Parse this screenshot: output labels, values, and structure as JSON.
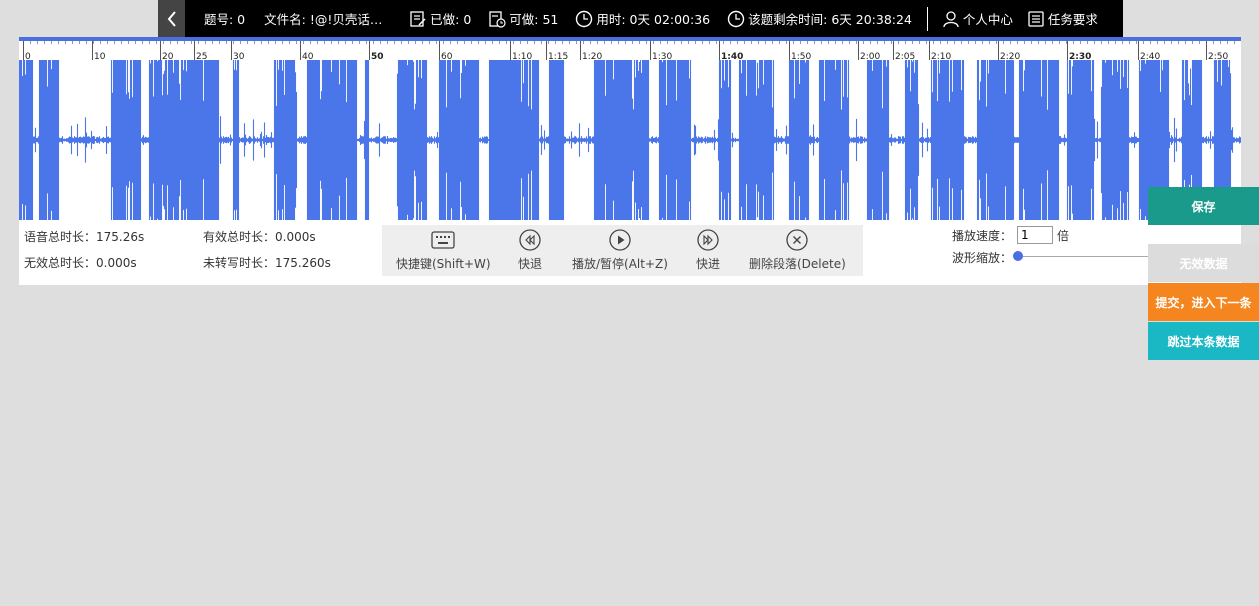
{
  "topbar": {
    "question_no": "题号: 0",
    "file_name": "文件名: !@!贝壳话…",
    "done": "已做: 0",
    "available": "可做: 51",
    "time_used": "用时: 0天 02:00:36",
    "time_left": "该题剩余时间: 6天 20:38:24",
    "user_center": "个人中心",
    "task_requirements": "任务要求"
  },
  "timeline": {
    "labels": [
      "0",
      "10",
      "20",
      "25",
      "30",
      "40",
      "50",
      "60",
      "1:10",
      "1:15",
      "1:20",
      "1:30",
      "1:40",
      "1:50",
      "2:00",
      "2:05",
      "2:10",
      "2:20",
      "2:30",
      "2:40",
      "2:50"
    ],
    "bold_labels": [
      "50",
      "1:40",
      "2:30"
    ]
  },
  "stats": {
    "speech_total": "语音总时长：175.26s",
    "valid_total": "有效总时长：0.000s",
    "invalid_total": "无效总时长：0.000s",
    "untranscribed": "未转写时长：175.260s"
  },
  "controls": {
    "shortcut": "快捷键(Shift+W)",
    "rewind": "快退",
    "play_pause": "播放/暂停(Alt+Z)",
    "forward": "快进",
    "delete_segment": "删除段落(Delete)"
  },
  "playback": {
    "speed_label": "播放速度：",
    "speed_value": "1",
    "speed_unit": "倍",
    "zoom_label": "波形缩放："
  },
  "side_buttons": {
    "save": "保存",
    "invalid": "无效数据",
    "submit_next": "提交，进入下一条",
    "skip": "跳过本条数据"
  },
  "colors": {
    "wave": "#4a76ea",
    "save": "#1a9a8a",
    "invalid": "#dcdcdc",
    "submit": "#f5861f",
    "skip": "#1ab7c4"
  }
}
